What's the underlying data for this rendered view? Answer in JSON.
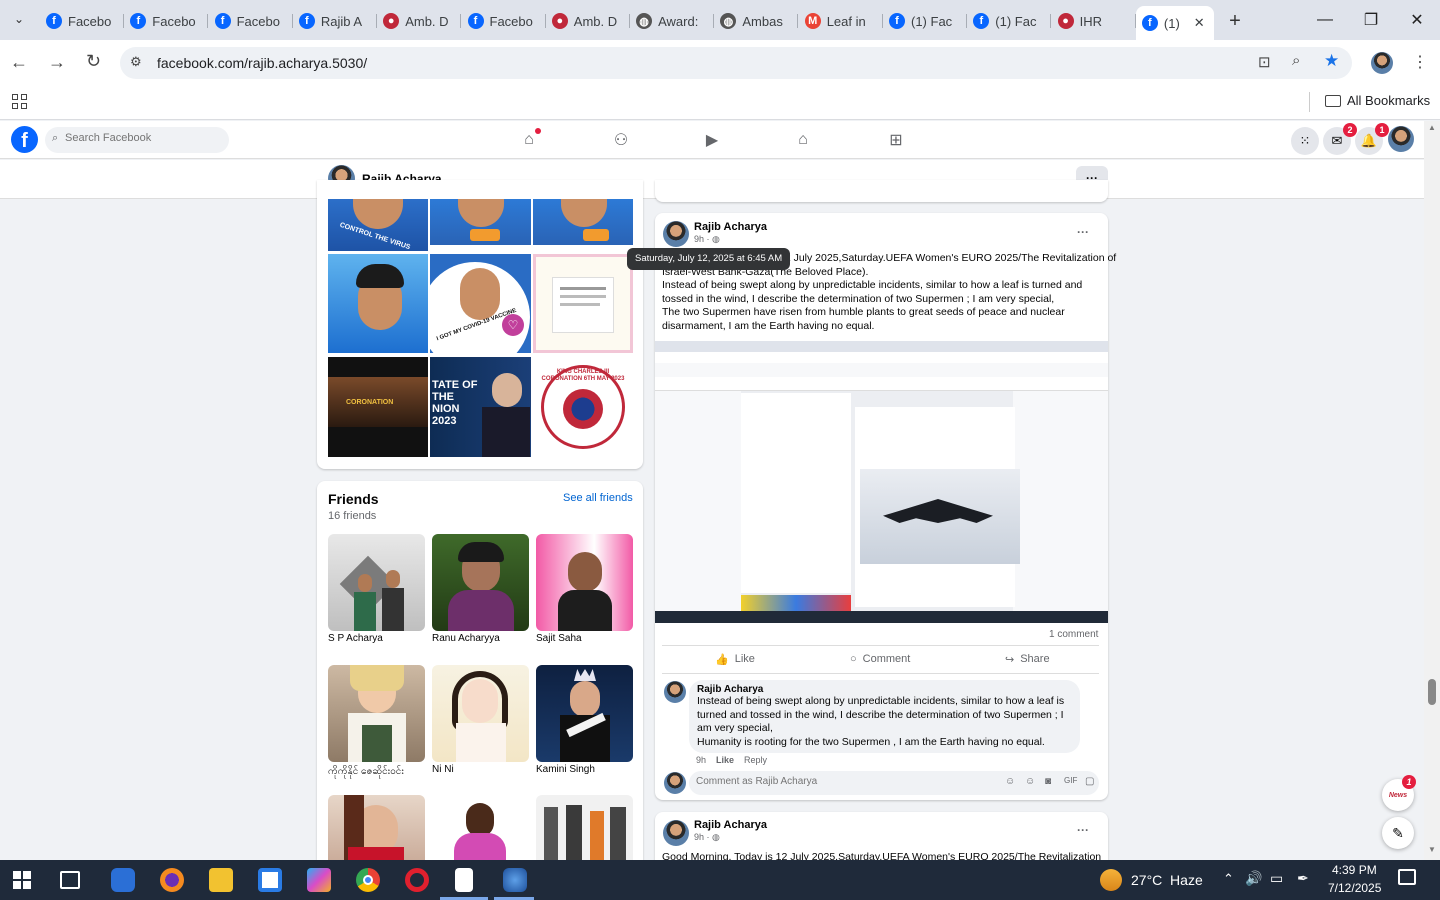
{
  "browser": {
    "tabs": [
      {
        "label": "Facebo",
        "icon": "facebook-icon"
      },
      {
        "label": "Facebo",
        "icon": "facebook-icon"
      },
      {
        "label": "Facebo",
        "icon": "facebook-icon"
      },
      {
        "label": "Rajib A",
        "icon": "facebook-icon"
      },
      {
        "label": "Amb. D",
        "icon": "ambassador-icon"
      },
      {
        "label": "Facebo",
        "icon": "facebook-icon"
      },
      {
        "label": "Amb. D",
        "icon": "ambassador-icon"
      },
      {
        "label": "Award:",
        "icon": "globe-icon"
      },
      {
        "label": "Ambas",
        "icon": "globe-icon"
      },
      {
        "label": "Leaf in",
        "icon": "gmail-icon"
      },
      {
        "label": "(1) Fac",
        "icon": "facebook-icon"
      },
      {
        "label": "(1) Fac",
        "icon": "facebook-icon"
      },
      {
        "label": "IHR",
        "icon": "ambassador-icon"
      },
      {
        "label": "(1)",
        "icon": "facebook-icon"
      }
    ],
    "new_tab": "+",
    "url": "facebook.com/rajib.acharya.5030/",
    "bookmarks_label": "All Bookmarks"
  },
  "fb": {
    "search_placeholder": "Search Facebook",
    "messenger_badge": "2",
    "notifications_badge": "1",
    "profile_name": "Rajib Acharya",
    "photo_captions": {
      "p1": "CONTROL THE VIRUS",
      "p5": "I GOT MY COVID-19 VACCINE",
      "p7": "CORONATION",
      "p8": "TATE OF THE NION 2023",
      "p9": "KING CHARLES III CORONATION 6TH MAY 2023"
    },
    "friends": {
      "title": "Friends",
      "count": "16 friends",
      "see_all": "See all friends",
      "list": [
        {
          "name": "S P Acharya"
        },
        {
          "name": "Ranu Acharyya"
        },
        {
          "name": "Sajit Saha"
        },
        {
          "name": "ကိုကိုနိုင် ဇေဆိုင်းဝင်း"
        },
        {
          "name": "Ni Ni"
        },
        {
          "name": "Kamini Singh"
        }
      ]
    },
    "post1": {
      "author": "Rajib Acharya",
      "time": "9h",
      "tooltip": "Saturday, July 12, 2025 at 6:45 AM",
      "line1_visible": "12 July 2025,Saturday.UEFA Women's EURO 2025/The Revitalization of",
      "line2_visible": "Israel-West Bank-Gaza(The Beloved Place).",
      "para2": "Instead of being swept along by unpredictable incidents, similar to how a leaf is turned and tossed in the wind, I describe the determination of two Supermen ; I am very special,",
      "para3": "The two Supermen have risen from humble plants to great seeds of peace and nuclear disarmament, I am the Earth having no equal.",
      "comment_count": "1 comment",
      "like": "Like",
      "comment": "Comment",
      "share": "Share",
      "reply": {
        "author": "Rajib Acharya",
        "text1": "Instead of being swept along by unpredictable incidents, similar to how a leaf is turned and tossed in the wind, I describe the determination of two Supermen ; I am very special,",
        "text2": "Humanity is rooting for the two Supermen , I am the Earth having no equal.",
        "time": "9h",
        "like": "Like",
        "reply": "Reply"
      },
      "comment_placeholder": "Comment as Rajib Acharya"
    },
    "post2": {
      "author": "Rajib Acharya",
      "time": "9h",
      "text": "Good Morning, Today is 12 July 2025,Saturday.UEFA Women's EURO 2025/The Revitalization of"
    },
    "news_badge": "1",
    "news_label": "News"
  },
  "taskbar": {
    "weather": "27°C  Haze",
    "time": "4:39 PM",
    "date": "7/12/2025"
  },
  "colors": {
    "fb_blue": "#0866ff",
    "badge_red": "#e41e3f",
    "link": "#0064d1"
  }
}
